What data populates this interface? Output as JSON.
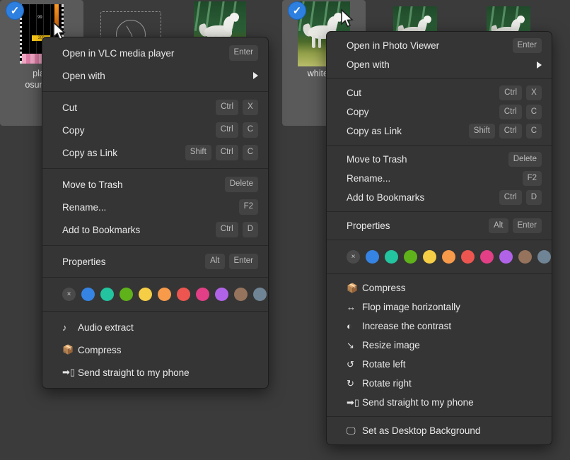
{
  "desktop": {
    "background_color": "#3b3b3b",
    "selection_color": "#5a5a5a"
  },
  "file_manager": {
    "items": [
      {
        "name": "playing osumania",
        "label": "playi\nosumani",
        "type": "video-thumbnail",
        "selected": true,
        "checked": true
      },
      {
        "name": "clock placeholder",
        "label": "",
        "type": "clock-thumbnail",
        "selected": false,
        "checked": false
      },
      {
        "name": "white horse",
        "label": "",
        "type": "photo-thumbnail",
        "selected": false,
        "checked": false
      },
      {
        "name": "white horse",
        "label": "white ho",
        "type": "photo-thumbnail",
        "selected": true,
        "checked": true
      },
      {
        "name": "white horse",
        "label": "",
        "type": "photo-thumbnail",
        "selected": false,
        "checked": false
      },
      {
        "name": "white horse",
        "label": "",
        "type": "photo-thumbnail",
        "selected": false,
        "checked": false
      }
    ]
  },
  "color_tags": {
    "none_label": "×",
    "colors": [
      "#3584e4",
      "#2ec27e",
      "#5fb21a",
      "#f6ce45",
      "#f79240",
      "#ef5martin",
      "#e8588a",
      "#b playful",
      "#9c7a63",
      "#6f8494"
    ],
    "swatches": [
      {
        "name": "none",
        "color": "#4a4a4a"
      },
      {
        "name": "blue",
        "color": "#3584e4"
      },
      {
        "name": "teal",
        "color": "#23c4a0"
      },
      {
        "name": "green",
        "color": "#5fb21a"
      },
      {
        "name": "yellow",
        "color": "#f6ce45"
      },
      {
        "name": "orange",
        "color": "#f79a4a"
      },
      {
        "name": "red",
        "color": "#ed5650"
      },
      {
        "name": "pink",
        "color": "#e23f86"
      },
      {
        "name": "purple",
        "color": "#b濃"
      },
      {
        "name": "brown",
        "color": "#96735c"
      },
      {
        "name": "slate",
        "color": "#6f8494"
      }
    ]
  },
  "menu_video": {
    "name": "video-context-menu",
    "groups": [
      {
        "items": [
          {
            "label": "Open in VLC media player",
            "keys": [
              "Enter"
            ],
            "icon": null,
            "submenu": false
          },
          {
            "label": "Open with",
            "keys": [],
            "icon": null,
            "submenu": true
          }
        ]
      },
      {
        "items": [
          {
            "label": "Cut",
            "keys": [
              "Ctrl",
              "X"
            ],
            "icon": null,
            "submenu": false
          },
          {
            "label": "Copy",
            "keys": [
              "Ctrl",
              "C"
            ],
            "icon": null,
            "submenu": false
          },
          {
            "label": "Copy as Link",
            "keys": [
              "Shift",
              "Ctrl",
              "C"
            ],
            "icon": null,
            "submenu": false
          }
        ]
      },
      {
        "items": [
          {
            "label": "Move to Trash",
            "keys": [
              "Delete"
            ],
            "icon": null,
            "submenu": false
          },
          {
            "label": "Rename...",
            "keys": [
              "F2"
            ],
            "icon": null,
            "submenu": false
          },
          {
            "label": "Add to Bookmarks",
            "keys": [
              "Ctrl",
              "D"
            ],
            "icon": null,
            "submenu": false
          }
        ]
      },
      {
        "items": [
          {
            "label": "Properties",
            "keys": [
              "Alt",
              "Enter"
            ],
            "icon": null,
            "submenu": false
          }
        ]
      },
      {
        "swatches": true,
        "items": []
      },
      {
        "items": [
          {
            "label": "Audio extract",
            "keys": [],
            "icon": "♪",
            "submenu": false
          },
          {
            "label": "Compress",
            "keys": [],
            "icon": "📦",
            "submenu": false
          },
          {
            "label": "Send straight to my phone",
            "keys": [],
            "icon": "➡▯",
            "submenu": false
          }
        ]
      }
    ]
  },
  "menu_image": {
    "name": "image-context-menu",
    "groups": [
      {
        "items": [
          {
            "label": "Open in Photo Viewer",
            "keys": [
              "Enter"
            ],
            "icon": null,
            "submenu": false
          },
          {
            "label": "Open with",
            "keys": [],
            "icon": null,
            "submenu": true
          }
        ]
      },
      {
        "items": [
          {
            "label": "Cut",
            "keys": [
              "Ctrl",
              "X"
            ],
            "icon": null,
            "submenu": false
          },
          {
            "label": "Copy",
            "keys": [
              "Ctrl",
              "C"
            ],
            "icon": null,
            "submenu": false
          },
          {
            "label": "Copy as Link",
            "keys": [
              "Shift",
              "Ctrl",
              "C"
            ],
            "icon": null,
            "submenu": false
          }
        ]
      },
      {
        "items": [
          {
            "label": "Move to Trash",
            "keys": [
              "Delete"
            ],
            "icon": null,
            "submenu": false
          },
          {
            "label": "Rename...",
            "keys": [
              "F2"
            ],
            "icon": null,
            "submenu": false
          },
          {
            "label": "Add to Bookmarks",
            "keys": [
              "Ctrl",
              "D"
            ],
            "icon": null,
            "submenu": false
          }
        ]
      },
      {
        "items": [
          {
            "label": "Properties",
            "keys": [
              "Alt",
              "Enter"
            ],
            "icon": null,
            "submenu": false
          }
        ]
      },
      {
        "swatches": true,
        "items": []
      },
      {
        "items": [
          {
            "label": "Compress",
            "keys": [],
            "icon": "📦",
            "submenu": false
          },
          {
            "label": "Flop image horizontally",
            "keys": [],
            "icon": "↔",
            "submenu": false
          },
          {
            "label": "Increase the contrast",
            "keys": [],
            "icon": "◐",
            "submenu": false
          },
          {
            "label": "Resize image",
            "keys": [],
            "icon": "↘",
            "submenu": false
          },
          {
            "label": "Rotate left",
            "keys": [],
            "icon": "↺",
            "submenu": false
          },
          {
            "label": "Rotate right",
            "keys": [],
            "icon": "↻",
            "submenu": false
          },
          {
            "label": "Send straight to my phone",
            "keys": [],
            "icon": "➡▯",
            "submenu": false
          }
        ]
      },
      {
        "items": [
          {
            "label": "Set as Desktop Background",
            "keys": [],
            "icon": "🖵",
            "submenu": false
          }
        ]
      }
    ]
  }
}
